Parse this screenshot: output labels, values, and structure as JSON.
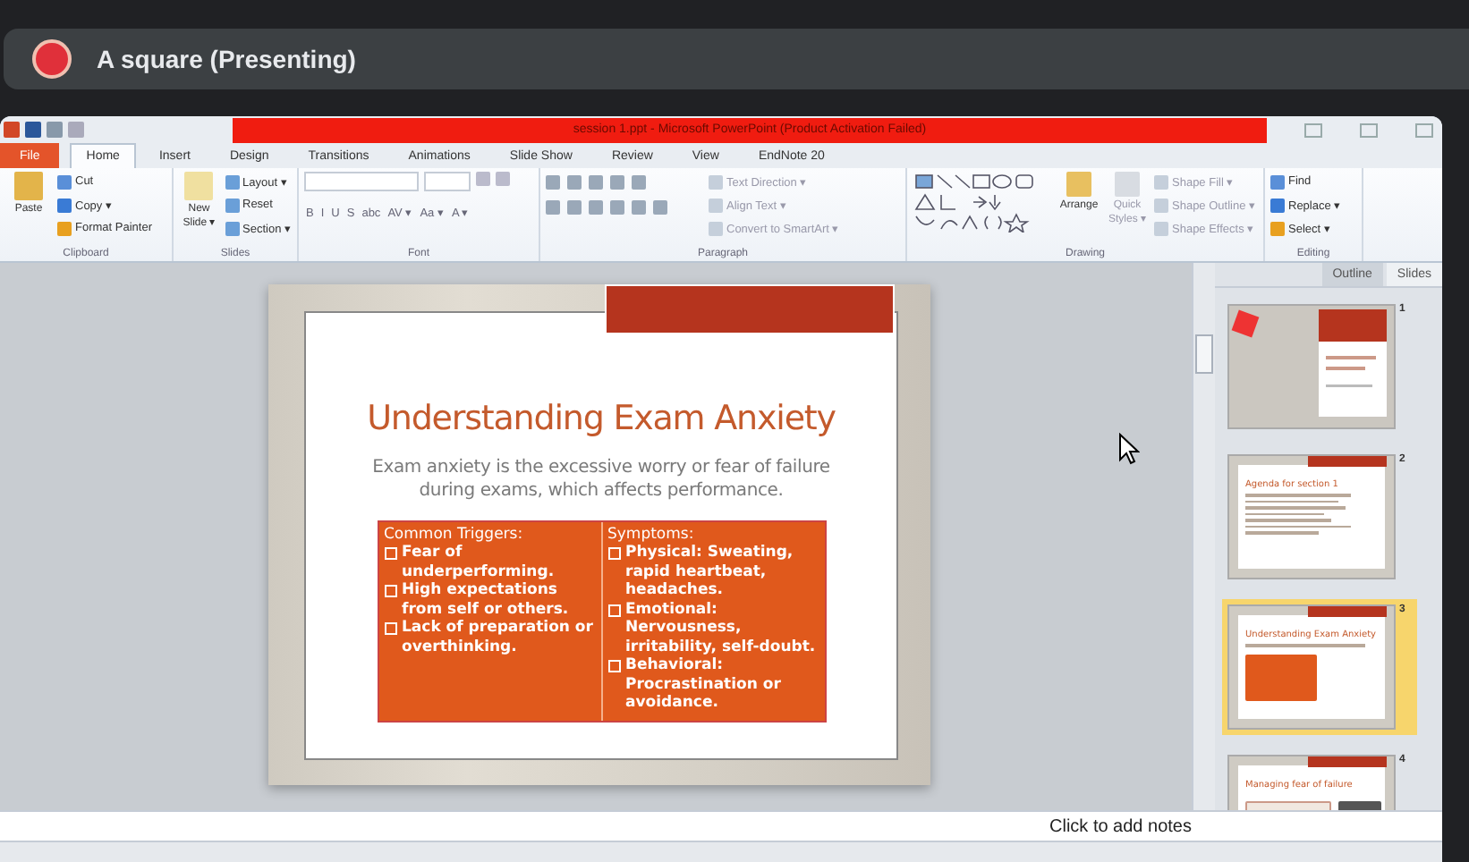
{
  "meeting": {
    "title": "A square (Presenting)"
  },
  "window": {
    "title": "session 1.ppt - Microsoft PowerPoint (Product Activation Failed)"
  },
  "tabs": [
    {
      "label": "File",
      "kind": "file",
      "selected": false
    },
    {
      "label": "Home",
      "kind": "tab",
      "selected": true
    },
    {
      "label": "Insert",
      "kind": "tab",
      "selected": false
    },
    {
      "label": "Design",
      "kind": "tab",
      "selected": false
    },
    {
      "label": "Transitions",
      "kind": "tab",
      "selected": false
    },
    {
      "label": "Animations",
      "kind": "tab",
      "selected": false
    },
    {
      "label": "Slide Show",
      "kind": "tab",
      "selected": false
    },
    {
      "label": "Review",
      "kind": "tab",
      "selected": false
    },
    {
      "label": "View",
      "kind": "tab",
      "selected": false
    },
    {
      "label": "EndNote 20",
      "kind": "tab",
      "selected": false
    }
  ],
  "ribbon": {
    "clipboard": {
      "label": "Clipboard",
      "paste": "Paste",
      "items": [
        "Cut",
        "Copy ▾",
        "Format Painter"
      ]
    },
    "slides": {
      "label": "Slides",
      "new_slide": "New Slide ▾",
      "items": [
        "Layout ▾",
        "Reset",
        "Section ▾"
      ]
    },
    "font": {
      "label": "Font",
      "buttons": [
        "B",
        "I",
        "U",
        "S",
        "abc",
        "AV ▾",
        "Aa ▾",
        "A ▾"
      ]
    },
    "paragraph": {
      "label": "Paragraph",
      "items": [
        "Text Direction ▾",
        "Align Text ▾",
        "Convert to SmartArt ▾"
      ]
    },
    "drawing": {
      "label": "Drawing",
      "arrange": "Arrange",
      "quick_styles": "Quick Styles ▾",
      "items": [
        "Shape Fill ▾",
        "Shape Outline ▾",
        "Shape Effects ▾"
      ]
    },
    "editing": {
      "label": "Editing",
      "items": [
        "Find",
        "Replace ▾",
        "Select ▾"
      ]
    }
  },
  "slide": {
    "title": "Understanding Exam Anxiety",
    "subtitle": "Exam anxiety is the excessive worry or fear of failure during exams, which affects performance.",
    "columns": [
      {
        "heading": "Common Triggers:",
        "bullets": [
          "Fear of underperforming.",
          "High expectations from self or others.",
          "Lack of preparation or overthinking."
        ]
      },
      {
        "heading": "Symptoms:",
        "bullets": [
          "Physical: Sweating, rapid heartbeat, headaches.",
          "Emotional: Nervousness, irritability, self-doubt.",
          "Behavioral: Procrastination or avoidance."
        ]
      }
    ]
  },
  "pane_tabs": [
    {
      "label": "Outline",
      "selected": false
    },
    {
      "label": "Slides",
      "selected": true
    }
  ],
  "thumbnails": [
    {
      "number": "1",
      "kind": "cover",
      "selected": false
    },
    {
      "number": "2",
      "kind": "text",
      "title": "Agenda for section 1",
      "selected": false
    },
    {
      "number": "3",
      "kind": "table",
      "title": "Understanding Exam Anxiety",
      "selected": true
    },
    {
      "number": "4",
      "kind": "image",
      "title": "Managing fear of failure",
      "selected": false
    }
  ],
  "notes": {
    "placeholder": "Click to add notes"
  }
}
